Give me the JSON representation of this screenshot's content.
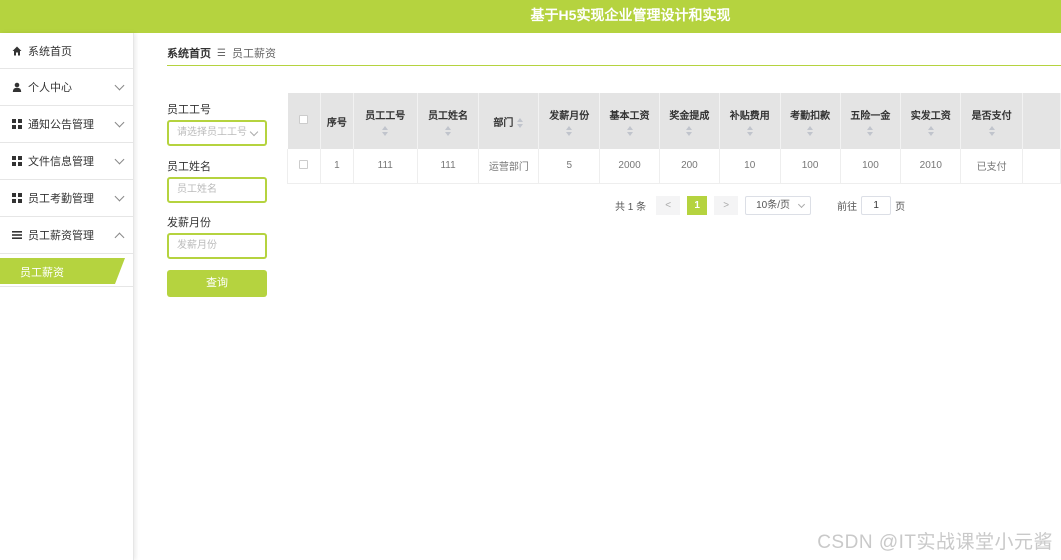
{
  "header": {
    "title": "基于H5实现企业管理设计和实现"
  },
  "sidebar": {
    "items": [
      {
        "label": "系统首页",
        "icon": "home-icon"
      },
      {
        "label": "个人中心",
        "icon": "user-icon",
        "expandable": true
      },
      {
        "label": "通知公告管理",
        "icon": "grid-icon",
        "expandable": true
      },
      {
        "label": "文件信息管理",
        "icon": "grid-icon",
        "expandable": true
      },
      {
        "label": "员工考勤管理",
        "icon": "grid-icon",
        "expandable": true
      },
      {
        "label": "员工薪资管理",
        "icon": "list-icon",
        "expandable": true,
        "expanded": true
      }
    ],
    "active_sub": "员工薪资"
  },
  "breadcrumb": {
    "home": "系统首页",
    "current": "员工薪资"
  },
  "search": {
    "employee_no_label": "员工工号",
    "employee_no_placeholder": "请选择员工工号",
    "employee_name_label": "员工姓名",
    "employee_name_placeholder": "员工姓名",
    "pay_month_label": "发薪月份",
    "pay_month_placeholder": "发薪月份",
    "query_button": "查询"
  },
  "table": {
    "headers": [
      "序号",
      "员工工号",
      "员工姓名",
      "部门",
      "发薪月份",
      "基本工资",
      "奖金提成",
      "补贴费用",
      "考勤扣款",
      "五险一金",
      "实发工资",
      "是否支付"
    ],
    "rows": [
      [
        "1",
        "111",
        "111",
        "运营部门",
        "5",
        "2000",
        "200",
        "10",
        "100",
        "100",
        "2010",
        "已支付"
      ]
    ]
  },
  "pagination": {
    "total": "共 1 条",
    "prev": "<",
    "current_page": "1",
    "next": ">",
    "page_size": "10条/页",
    "jump_prefix": "前往",
    "jump_value": "1",
    "jump_suffix": "页"
  },
  "watermark": "CSDN @IT实战课堂小元酱",
  "colors": {
    "accent": "#b5d33f",
    "table_header_bg": "#e4e4e4"
  }
}
